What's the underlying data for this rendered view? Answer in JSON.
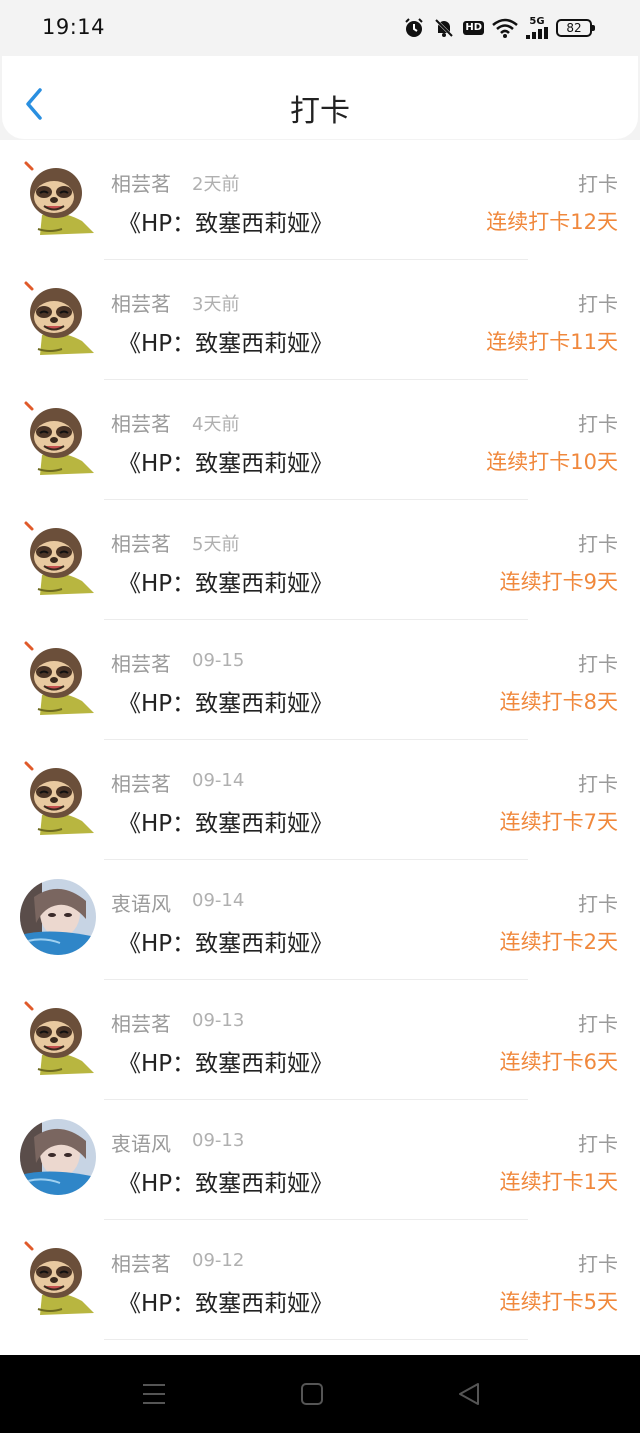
{
  "status_bar": {
    "time": "19:14",
    "hd": "HD",
    "network": "5G",
    "battery": "82"
  },
  "header": {
    "title": "打卡"
  },
  "items": [
    {
      "user": "相芸茗",
      "avatar": "sloth-avatar",
      "time": "2天前",
      "book": "《HP：致塞西莉娅》",
      "label": "打卡",
      "streak": "连续打卡12天"
    },
    {
      "user": "相芸茗",
      "avatar": "sloth-avatar",
      "time": "3天前",
      "book": "《HP：致塞西莉娅》",
      "label": "打卡",
      "streak": "连续打卡11天"
    },
    {
      "user": "相芸茗",
      "avatar": "sloth-avatar",
      "time": "4天前",
      "book": "《HP：致塞西莉娅》",
      "label": "打卡",
      "streak": "连续打卡10天"
    },
    {
      "user": "相芸茗",
      "avatar": "sloth-avatar",
      "time": "5天前",
      "book": "《HP：致塞西莉娅》",
      "label": "打卡",
      "streak": "连续打卡9天"
    },
    {
      "user": "相芸茗",
      "avatar": "sloth-avatar",
      "time": "09-15",
      "book": "《HP：致塞西莉娅》",
      "label": "打卡",
      "streak": "连续打卡8天"
    },
    {
      "user": "相芸茗",
      "avatar": "sloth-avatar",
      "time": "09-14",
      "book": "《HP：致塞西莉娅》",
      "label": "打卡",
      "streak": "连续打卡7天"
    },
    {
      "user": "衷语风",
      "avatar": "photo-avatar",
      "time": "09-14",
      "book": "《HP：致塞西莉娅》",
      "label": "打卡",
      "streak": "连续打卡2天"
    },
    {
      "user": "相芸茗",
      "avatar": "sloth-avatar",
      "time": "09-13",
      "book": "《HP：致塞西莉娅》",
      "label": "打卡",
      "streak": "连续打卡6天"
    },
    {
      "user": "衷语风",
      "avatar": "photo-avatar",
      "time": "09-13",
      "book": "《HP：致塞西莉娅》",
      "label": "打卡",
      "streak": "连续打卡1天"
    },
    {
      "user": "相芸茗",
      "avatar": "sloth-avatar",
      "time": "09-12",
      "book": "《HP：致塞西莉娅》",
      "label": "打卡",
      "streak": "连续打卡5天"
    }
  ],
  "colors": {
    "accent": "#2a8fe0",
    "streak": "#f0883c",
    "muted": "#9a9a9a"
  },
  "nav": {
    "icons": [
      "menu-icon",
      "home-icon",
      "back-triangle-icon"
    ]
  }
}
